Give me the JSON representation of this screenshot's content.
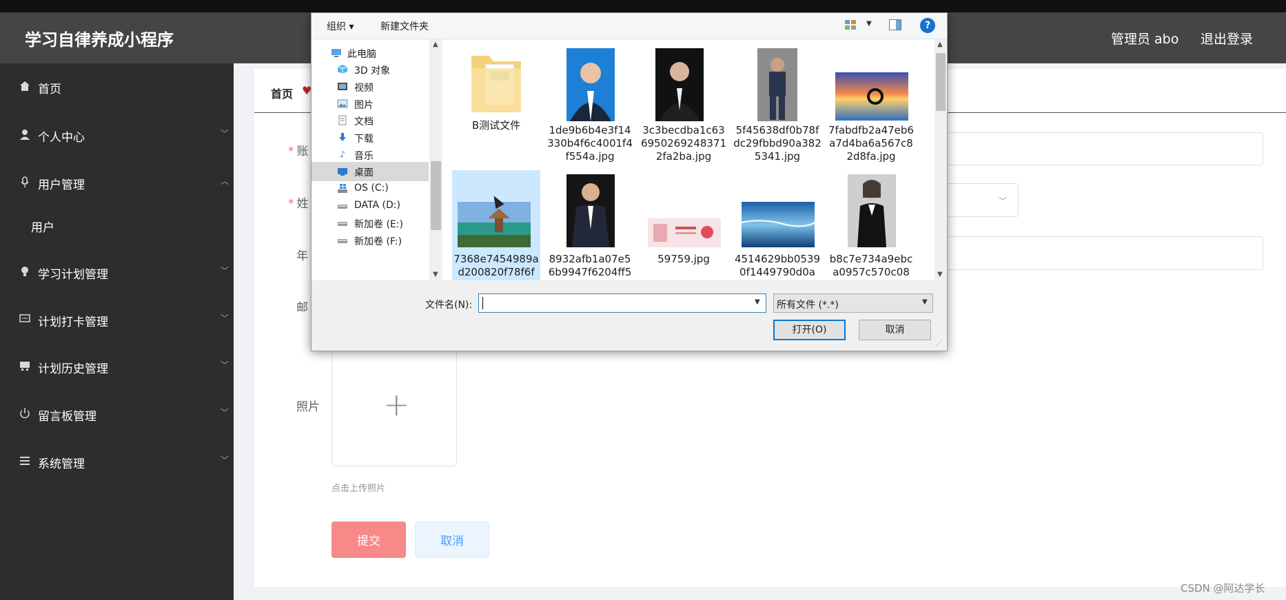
{
  "header": {
    "app_title": "学习自律养成小程序",
    "admin": "管理员 abo",
    "logout": "退出登录"
  },
  "sidebar": {
    "items": [
      {
        "label": "首页",
        "icon": "home-icon"
      },
      {
        "label": "个人中心",
        "icon": "user-icon"
      },
      {
        "label": "用户管理",
        "icon": "microphone-icon"
      },
      {
        "label": "用户",
        "icon": ""
      },
      {
        "label": "学习计划管理",
        "icon": "bulb-icon"
      },
      {
        "label": "计划打卡管理",
        "icon": "chat-icon"
      },
      {
        "label": "计划历史管理",
        "icon": "archive-icon"
      },
      {
        "label": "留言板管理",
        "icon": "power-icon"
      },
      {
        "label": "系统管理",
        "icon": "list-icon"
      }
    ]
  },
  "breadcrumb": {
    "label": "首页"
  },
  "form": {
    "labels": [
      "账",
      "姓",
      "年",
      "邮",
      "照片"
    ],
    "upload_tip": "点击上传照片",
    "submit": "提交",
    "cancel": "取消"
  },
  "watermark": "CSDN @阿达学长",
  "dialog": {
    "toolbar": {
      "organize": "组织 ▾",
      "new_folder": "新建文件夹",
      "help": "?"
    },
    "nav": [
      {
        "label": "此电脑",
        "icon": "computer-icon"
      },
      {
        "label": "3D 对象",
        "icon": "cube-icon"
      },
      {
        "label": "视频",
        "icon": "video-icon"
      },
      {
        "label": "图片",
        "icon": "picture-icon"
      },
      {
        "label": "文档",
        "icon": "document-icon"
      },
      {
        "label": "下载",
        "icon": "download-icon"
      },
      {
        "label": "音乐",
        "icon": "music-icon"
      },
      {
        "label": "桌面",
        "icon": "desktop-icon"
      },
      {
        "label": "OS (C:)",
        "icon": "windows-drive-icon"
      },
      {
        "label": "DATA (D:)",
        "icon": "drive-icon"
      },
      {
        "label": "新加卷 (E:)",
        "icon": "drive-icon"
      },
      {
        "label": "新加卷 (F:)",
        "icon": "drive-icon"
      }
    ],
    "files": [
      {
        "name": "B测试文件",
        "kind": "folder"
      },
      {
        "name": "1de9b6b4e3f14330b4f6c4001f4f554a.jpg",
        "kind": "portrait-blue"
      },
      {
        "name": "3c3becdba1c6369502692483712fa2ba.jpg",
        "kind": "portrait-dark"
      },
      {
        "name": "5f45638df0b78fdc29fbbd90a3825341.jpg",
        "kind": "portrait-sitting"
      },
      {
        "name": "7fabdfb2a47eb6a7d4ba6a567c82d8fa.jpg",
        "kind": "sunset"
      },
      {
        "name": "7368e7454989ad200820f78f6f",
        "kind": "landscape-island"
      },
      {
        "name": "8932afb1a07e56b9947f6204ff5",
        "kind": "portrait-suit"
      },
      {
        "name": "59759.jpg",
        "kind": "banner-pink"
      },
      {
        "name": "4514629bb05390f1449790d0a",
        "kind": "sea"
      },
      {
        "name": "b8c7e734a9ebca0957c570c08",
        "kind": "portrait-woman"
      }
    ],
    "filename_label": "文件名(N):",
    "filename_value": "",
    "filetype": "所有文件 (*.*)",
    "open_button": "打开(O)",
    "cancel_button": "取消"
  }
}
